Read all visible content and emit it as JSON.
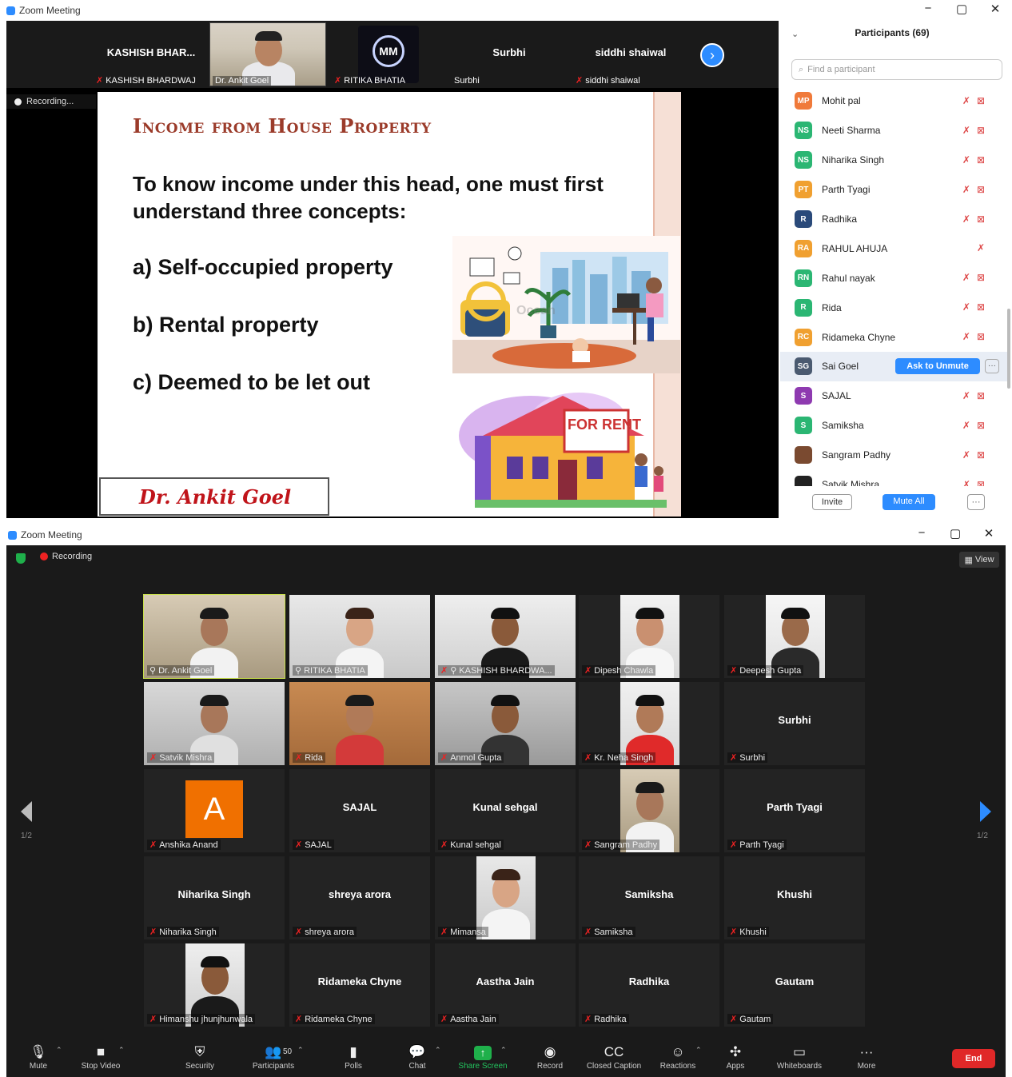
{
  "top_window": {
    "title": "Zoom Meeting",
    "controls": {
      "minimize": "−",
      "restore": "▢",
      "close": "✕"
    },
    "recording_label": "Recording...",
    "strip": [
      {
        "name": "KASHISH  BHAR...",
        "label": "KASHISH BHARDWAJ",
        "muted": true,
        "type": "name"
      },
      {
        "name": "",
        "label": "Dr. Ankit Goel",
        "muted": false,
        "type": "video"
      },
      {
        "name": "",
        "label": "RITIKA BHATIA",
        "muted": true,
        "type": "logo",
        "logo_text": "MM"
      },
      {
        "name": "Surbhi",
        "label": "Surbhi",
        "muted": false,
        "type": "name"
      },
      {
        "name": "siddhi shaiwal",
        "label": "siddhi shaiwal",
        "muted": true,
        "type": "name"
      }
    ],
    "next_icon": "chevron-right-icon",
    "slide": {
      "title": "Income from House Property",
      "intro": "To know income under this head, one must first understand three concepts:",
      "concepts": [
        "a) Self-occupied property",
        "b) Rental property",
        "c) Deemed to be let out"
      ],
      "signature": "Dr. Ankit Goel",
      "rent_sign": "FOR RENT"
    },
    "participants_panel": {
      "title": "Participants (69)",
      "search_placeholder": "Find a participant",
      "rows": [
        {
          "initials": "MP",
          "name": "Mohit pal",
          "color": "#f07a3a"
        },
        {
          "initials": "NS",
          "name": "Neeti Sharma",
          "color": "#2bb673"
        },
        {
          "initials": "NS",
          "name": "Niharika Singh",
          "color": "#2bb673"
        },
        {
          "initials": "PT",
          "name": "Parth Tyagi",
          "color": "#f0a030"
        },
        {
          "initials": "R",
          "name": "Radhika",
          "color": "#2a4a7a"
        },
        {
          "initials": "RA",
          "name": "RAHUL AHUJA",
          "color": "#f0a030"
        },
        {
          "initials": "RN",
          "name": "Rahul nayak",
          "color": "#2bb673"
        },
        {
          "initials": "R",
          "name": "Rida",
          "color": "#2bb673"
        },
        {
          "initials": "RC",
          "name": "Ridameka Chyne",
          "color": "#f0a030"
        },
        {
          "initials": "SG",
          "name": "Sai Goel",
          "color": "#4a5a70",
          "selected": true
        },
        {
          "initials": "S",
          "name": "SAJAL",
          "color": "#8e3ab0"
        },
        {
          "initials": "S",
          "name": "Samiksha",
          "color": "#2bb673"
        },
        {
          "initials": "",
          "name": "Sangram Padhy",
          "color": "#7a4a30"
        },
        {
          "initials": "",
          "name": "Satvik Mishra",
          "color": "#222"
        }
      ],
      "ask_to_unmute": "Ask to Unmute",
      "invite": "Invite",
      "mute_all": "Mute All",
      "more": "···"
    }
  },
  "bottom_window": {
    "title": "Zoom Meeting",
    "recording_label": "Recording",
    "view_label": "View",
    "page_left": "1/2",
    "page_right": "1/2",
    "tiles": [
      {
        "label": "Dr. Ankit Goel",
        "display": "",
        "type": "video",
        "active": true,
        "pinned": true
      },
      {
        "label": "RITIKA BHATIA",
        "display": "",
        "type": "video",
        "pinned": true
      },
      {
        "label": "KASHISH BHARDWA...",
        "display": "",
        "type": "video",
        "muted": true,
        "pinned": true
      },
      {
        "label": "Dipesh Chawla",
        "display": "",
        "type": "video",
        "muted": true
      },
      {
        "label": "Deepesh Gupta",
        "display": "",
        "type": "video",
        "muted": true
      },
      {
        "label": "Satvik Mishra",
        "display": "",
        "type": "video",
        "muted": true
      },
      {
        "label": "Rida",
        "display": "",
        "type": "video",
        "muted": true
      },
      {
        "label": "Anmol Gupta",
        "display": "",
        "type": "video",
        "muted": true
      },
      {
        "label": "Kr. Neha Singh",
        "display": "",
        "type": "video",
        "muted": true
      },
      {
        "label": "Surbhi",
        "display": "Surbhi",
        "type": "name",
        "muted": true
      },
      {
        "label": "Anshika Anand",
        "display": "A",
        "type": "avatar",
        "muted": true
      },
      {
        "label": "SAJAL",
        "display": "SAJAL",
        "type": "name",
        "muted": true
      },
      {
        "label": "Kunal sehgal",
        "display": "Kunal sehgal",
        "type": "name",
        "muted": true
      },
      {
        "label": "Sangram Padhy",
        "display": "",
        "type": "video",
        "muted": true
      },
      {
        "label": "Parth Tyagi",
        "display": "Parth Tyagi",
        "type": "name",
        "muted": true
      },
      {
        "label": "Niharika Singh",
        "display": "Niharika Singh",
        "type": "name",
        "muted": true
      },
      {
        "label": "shreya arora",
        "display": "shreya arora",
        "type": "name",
        "muted": true
      },
      {
        "label": "Mimansa",
        "display": "",
        "type": "video",
        "muted": true
      },
      {
        "label": "Samiksha",
        "display": "Samiksha",
        "type": "name",
        "muted": true
      },
      {
        "label": "Khushi",
        "display": "Khushi",
        "type": "name",
        "muted": true
      },
      {
        "label": "Himanshu jhunjhunwala",
        "display": "",
        "type": "video",
        "muted": true
      },
      {
        "label": "Ridameka Chyne",
        "display": "Ridameka Chyne",
        "type": "name",
        "muted": true
      },
      {
        "label": "Aastha Jain",
        "display": "Aastha Jain",
        "type": "name",
        "muted": true
      },
      {
        "label": "Radhika",
        "display": "Radhika",
        "type": "name",
        "muted": true
      },
      {
        "label": "Gautam",
        "display": "Gautam",
        "type": "name",
        "muted": true
      }
    ],
    "toolbar": [
      {
        "label": "Mute",
        "icon": "microphone-icon",
        "glyph": "🎙",
        "caret": true
      },
      {
        "label": "Stop Video",
        "icon": "video-camera-icon",
        "glyph": "■",
        "caret": true
      },
      {
        "label": "Security",
        "icon": "shield-icon",
        "glyph": "⛨",
        "caret": false
      },
      {
        "label": "Participants",
        "icon": "participants-icon",
        "glyph": "👥",
        "count": "50",
        "caret": true
      },
      {
        "label": "Polls",
        "icon": "polls-icon",
        "glyph": "▮",
        "caret": false
      },
      {
        "label": "Chat",
        "icon": "chat-icon",
        "glyph": "💬",
        "caret": true
      },
      {
        "label": "Share Screen",
        "icon": "share-screen-icon",
        "glyph": "↑",
        "caret": true,
        "green": true
      },
      {
        "label": "Record",
        "icon": "record-icon",
        "glyph": "◉",
        "caret": false
      },
      {
        "label": "Closed Caption",
        "icon": "closed-caption-icon",
        "glyph": "CC",
        "caret": false
      },
      {
        "label": "Reactions",
        "icon": "reactions-icon",
        "glyph": "☺",
        "caret": true
      },
      {
        "label": "Apps",
        "icon": "apps-icon",
        "glyph": "✣",
        "caret": false
      },
      {
        "label": "Whiteboards",
        "icon": "whiteboard-icon",
        "glyph": "▭",
        "caret": false
      },
      {
        "label": "More",
        "icon": "more-icon",
        "glyph": "···",
        "caret": false
      }
    ],
    "end_label": "End"
  }
}
